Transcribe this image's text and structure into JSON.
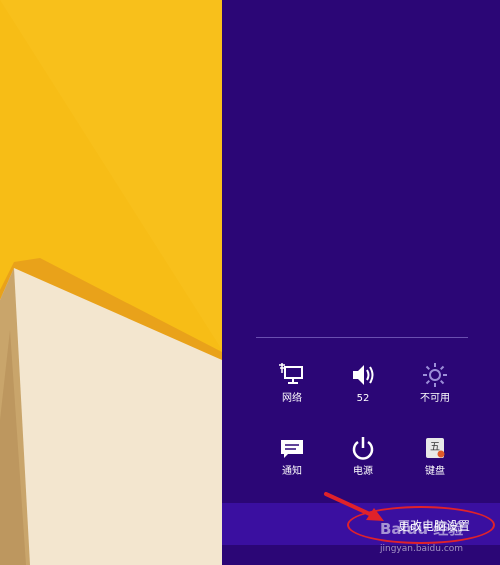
{
  "settings": {
    "quick_tiles": [
      {
        "label": "网络",
        "icon": "network-icon"
      },
      {
        "label": "52",
        "icon": "volume-icon"
      },
      {
        "label": "不可用",
        "icon": "brightness-icon"
      },
      {
        "label": "通知",
        "icon": "notifications-icon"
      },
      {
        "label": "电源",
        "icon": "power-icon"
      },
      {
        "label": "键盘",
        "icon": "keyboard-icon"
      }
    ],
    "more_settings_label": "更改电脑设置"
  },
  "watermark": {
    "logo_text": "Baidu 经验",
    "url": "jingyan.baidu.com"
  },
  "colors": {
    "panel_background": "#2b0676",
    "more_settings_bar": "#3a0fa0",
    "wallpaper_yellow": "#f7bd16",
    "wallpaper_cream": "#f3e6cf",
    "highlight_red": "#e0222a"
  }
}
